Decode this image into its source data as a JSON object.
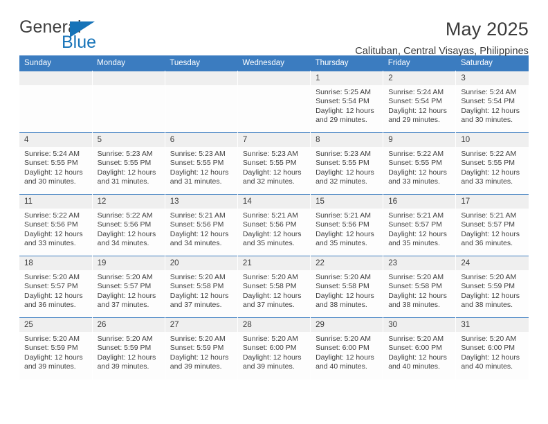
{
  "logo": {
    "primary_text": "General",
    "secondary_text": "Blue",
    "primary_color": "#3f3f3f",
    "accent_color": "#1673b8"
  },
  "header": {
    "title": "May 2025",
    "subtitle": "Calituban, Central Visayas, Philippines"
  },
  "theme": {
    "header_blue": "#3b7cc0",
    "daynum_band": "#efefef",
    "text": "#404040"
  },
  "weekday_headers": [
    "Sunday",
    "Monday",
    "Tuesday",
    "Wednesday",
    "Thursday",
    "Friday",
    "Saturday"
  ],
  "weeks": [
    [
      {
        "day": "",
        "sunrise": "",
        "sunset": "",
        "daylight_line1": "",
        "daylight_line2": ""
      },
      {
        "day": "",
        "sunrise": "",
        "sunset": "",
        "daylight_line1": "",
        "daylight_line2": ""
      },
      {
        "day": "",
        "sunrise": "",
        "sunset": "",
        "daylight_line1": "",
        "daylight_line2": ""
      },
      {
        "day": "",
        "sunrise": "",
        "sunset": "",
        "daylight_line1": "",
        "daylight_line2": ""
      },
      {
        "day": "1",
        "sunrise": "Sunrise: 5:25 AM",
        "sunset": "Sunset: 5:54 PM",
        "daylight_line1": "Daylight: 12 hours",
        "daylight_line2": "and 29 minutes."
      },
      {
        "day": "2",
        "sunrise": "Sunrise: 5:24 AM",
        "sunset": "Sunset: 5:54 PM",
        "daylight_line1": "Daylight: 12 hours",
        "daylight_line2": "and 29 minutes."
      },
      {
        "day": "3",
        "sunrise": "Sunrise: 5:24 AM",
        "sunset": "Sunset: 5:54 PM",
        "daylight_line1": "Daylight: 12 hours",
        "daylight_line2": "and 30 minutes."
      }
    ],
    [
      {
        "day": "4",
        "sunrise": "Sunrise: 5:24 AM",
        "sunset": "Sunset: 5:55 PM",
        "daylight_line1": "Daylight: 12 hours",
        "daylight_line2": "and 30 minutes."
      },
      {
        "day": "5",
        "sunrise": "Sunrise: 5:23 AM",
        "sunset": "Sunset: 5:55 PM",
        "daylight_line1": "Daylight: 12 hours",
        "daylight_line2": "and 31 minutes."
      },
      {
        "day": "6",
        "sunrise": "Sunrise: 5:23 AM",
        "sunset": "Sunset: 5:55 PM",
        "daylight_line1": "Daylight: 12 hours",
        "daylight_line2": "and 31 minutes."
      },
      {
        "day": "7",
        "sunrise": "Sunrise: 5:23 AM",
        "sunset": "Sunset: 5:55 PM",
        "daylight_line1": "Daylight: 12 hours",
        "daylight_line2": "and 32 minutes."
      },
      {
        "day": "8",
        "sunrise": "Sunrise: 5:23 AM",
        "sunset": "Sunset: 5:55 PM",
        "daylight_line1": "Daylight: 12 hours",
        "daylight_line2": "and 32 minutes."
      },
      {
        "day": "9",
        "sunrise": "Sunrise: 5:22 AM",
        "sunset": "Sunset: 5:55 PM",
        "daylight_line1": "Daylight: 12 hours",
        "daylight_line2": "and 33 minutes."
      },
      {
        "day": "10",
        "sunrise": "Sunrise: 5:22 AM",
        "sunset": "Sunset: 5:55 PM",
        "daylight_line1": "Daylight: 12 hours",
        "daylight_line2": "and 33 minutes."
      }
    ],
    [
      {
        "day": "11",
        "sunrise": "Sunrise: 5:22 AM",
        "sunset": "Sunset: 5:56 PM",
        "daylight_line1": "Daylight: 12 hours",
        "daylight_line2": "and 33 minutes."
      },
      {
        "day": "12",
        "sunrise": "Sunrise: 5:22 AM",
        "sunset": "Sunset: 5:56 PM",
        "daylight_line1": "Daylight: 12 hours",
        "daylight_line2": "and 34 minutes."
      },
      {
        "day": "13",
        "sunrise": "Sunrise: 5:21 AM",
        "sunset": "Sunset: 5:56 PM",
        "daylight_line1": "Daylight: 12 hours",
        "daylight_line2": "and 34 minutes."
      },
      {
        "day": "14",
        "sunrise": "Sunrise: 5:21 AM",
        "sunset": "Sunset: 5:56 PM",
        "daylight_line1": "Daylight: 12 hours",
        "daylight_line2": "and 35 minutes."
      },
      {
        "day": "15",
        "sunrise": "Sunrise: 5:21 AM",
        "sunset": "Sunset: 5:56 PM",
        "daylight_line1": "Daylight: 12 hours",
        "daylight_line2": "and 35 minutes."
      },
      {
        "day": "16",
        "sunrise": "Sunrise: 5:21 AM",
        "sunset": "Sunset: 5:57 PM",
        "daylight_line1": "Daylight: 12 hours",
        "daylight_line2": "and 35 minutes."
      },
      {
        "day": "17",
        "sunrise": "Sunrise: 5:21 AM",
        "sunset": "Sunset: 5:57 PM",
        "daylight_line1": "Daylight: 12 hours",
        "daylight_line2": "and 36 minutes."
      }
    ],
    [
      {
        "day": "18",
        "sunrise": "Sunrise: 5:20 AM",
        "sunset": "Sunset: 5:57 PM",
        "daylight_line1": "Daylight: 12 hours",
        "daylight_line2": "and 36 minutes."
      },
      {
        "day": "19",
        "sunrise": "Sunrise: 5:20 AM",
        "sunset": "Sunset: 5:57 PM",
        "daylight_line1": "Daylight: 12 hours",
        "daylight_line2": "and 37 minutes."
      },
      {
        "day": "20",
        "sunrise": "Sunrise: 5:20 AM",
        "sunset": "Sunset: 5:58 PM",
        "daylight_line1": "Daylight: 12 hours",
        "daylight_line2": "and 37 minutes."
      },
      {
        "day": "21",
        "sunrise": "Sunrise: 5:20 AM",
        "sunset": "Sunset: 5:58 PM",
        "daylight_line1": "Daylight: 12 hours",
        "daylight_line2": "and 37 minutes."
      },
      {
        "day": "22",
        "sunrise": "Sunrise: 5:20 AM",
        "sunset": "Sunset: 5:58 PM",
        "daylight_line1": "Daylight: 12 hours",
        "daylight_line2": "and 38 minutes."
      },
      {
        "day": "23",
        "sunrise": "Sunrise: 5:20 AM",
        "sunset": "Sunset: 5:58 PM",
        "daylight_line1": "Daylight: 12 hours",
        "daylight_line2": "and 38 minutes."
      },
      {
        "day": "24",
        "sunrise": "Sunrise: 5:20 AM",
        "sunset": "Sunset: 5:59 PM",
        "daylight_line1": "Daylight: 12 hours",
        "daylight_line2": "and 38 minutes."
      }
    ],
    [
      {
        "day": "25",
        "sunrise": "Sunrise: 5:20 AM",
        "sunset": "Sunset: 5:59 PM",
        "daylight_line1": "Daylight: 12 hours",
        "daylight_line2": "and 39 minutes."
      },
      {
        "day": "26",
        "sunrise": "Sunrise: 5:20 AM",
        "sunset": "Sunset: 5:59 PM",
        "daylight_line1": "Daylight: 12 hours",
        "daylight_line2": "and 39 minutes."
      },
      {
        "day": "27",
        "sunrise": "Sunrise: 5:20 AM",
        "sunset": "Sunset: 5:59 PM",
        "daylight_line1": "Daylight: 12 hours",
        "daylight_line2": "and 39 minutes."
      },
      {
        "day": "28",
        "sunrise": "Sunrise: 5:20 AM",
        "sunset": "Sunset: 6:00 PM",
        "daylight_line1": "Daylight: 12 hours",
        "daylight_line2": "and 39 minutes."
      },
      {
        "day": "29",
        "sunrise": "Sunrise: 5:20 AM",
        "sunset": "Sunset: 6:00 PM",
        "daylight_line1": "Daylight: 12 hours",
        "daylight_line2": "and 40 minutes."
      },
      {
        "day": "30",
        "sunrise": "Sunrise: 5:20 AM",
        "sunset": "Sunset: 6:00 PM",
        "daylight_line1": "Daylight: 12 hours",
        "daylight_line2": "and 40 minutes."
      },
      {
        "day": "31",
        "sunrise": "Sunrise: 5:20 AM",
        "sunset": "Sunset: 6:00 PM",
        "daylight_line1": "Daylight: 12 hours",
        "daylight_line2": "and 40 minutes."
      }
    ]
  ]
}
